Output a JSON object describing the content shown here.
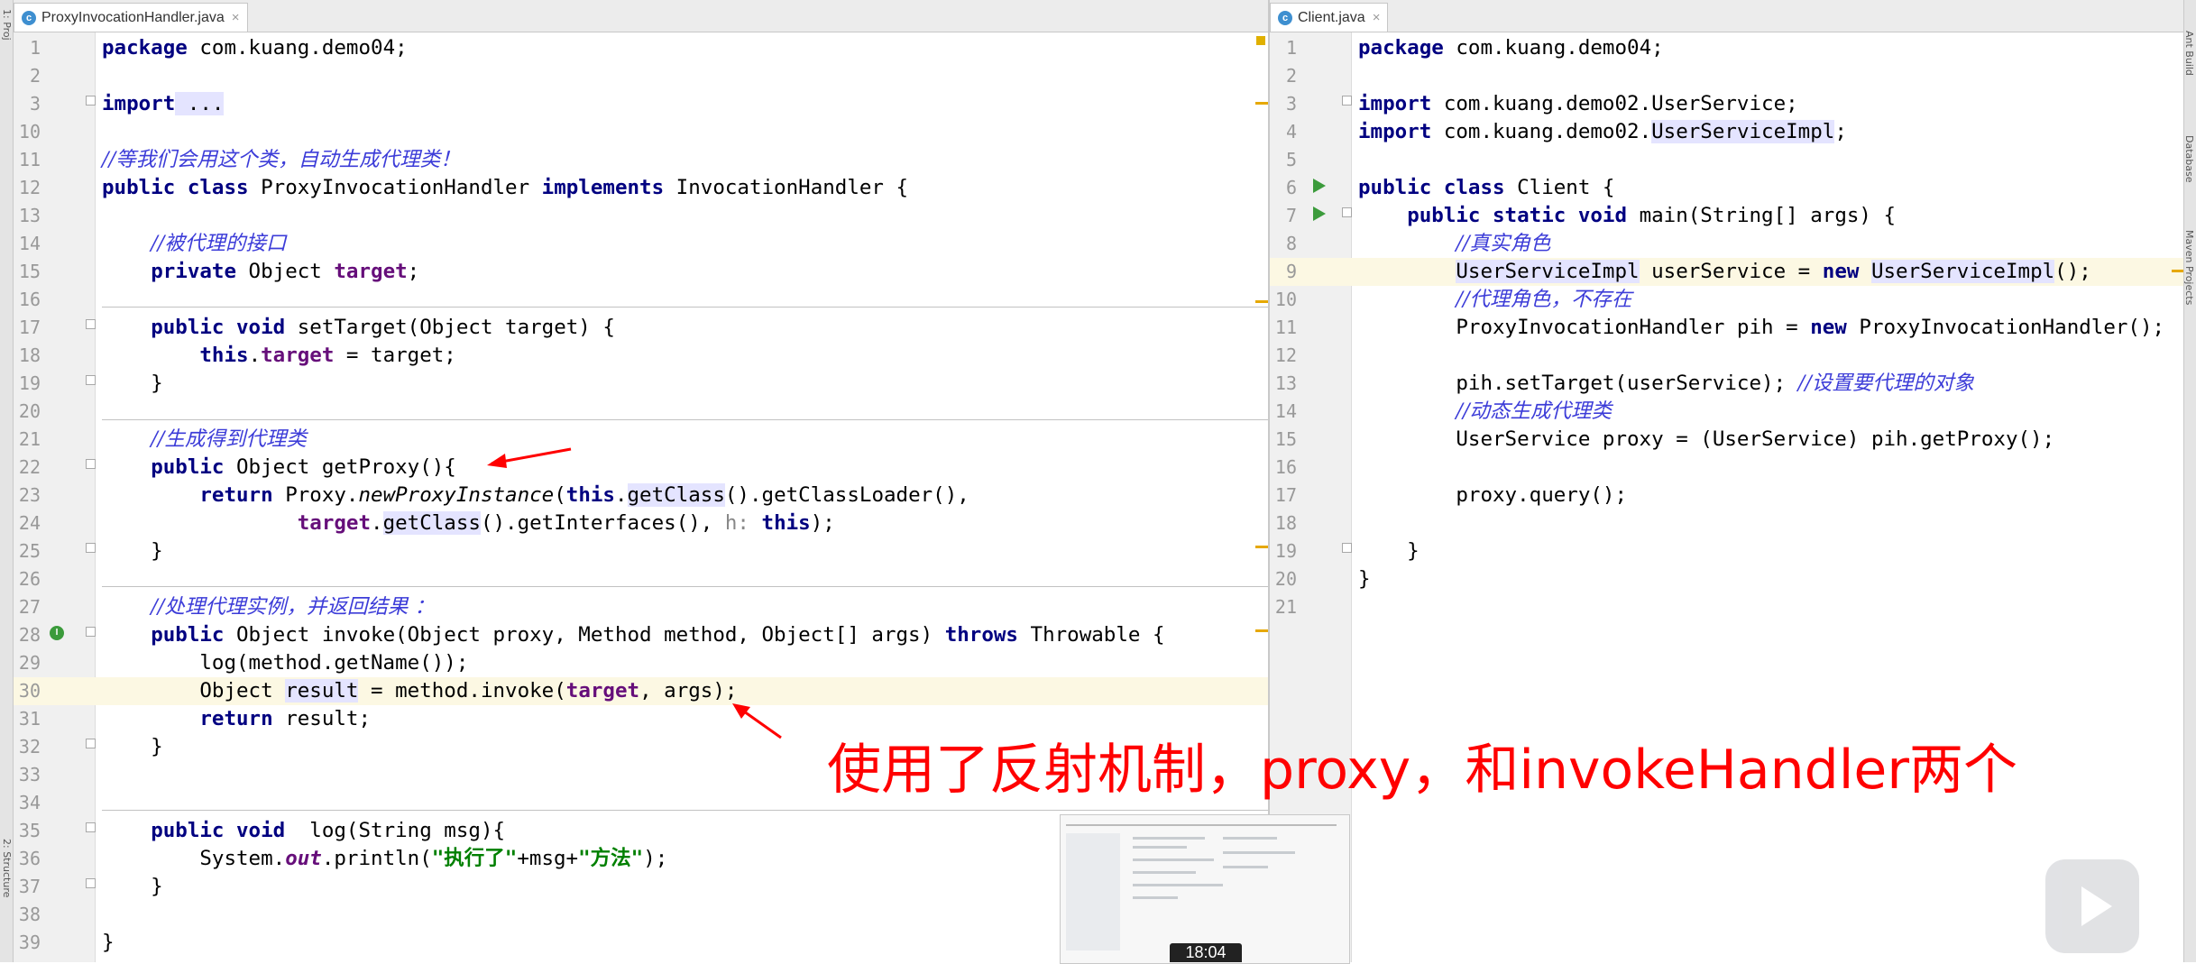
{
  "left_tab": {
    "label": "ProxyInvocationHandler.java",
    "close": "×"
  },
  "right_tab": {
    "label": "Client.java",
    "close": "×"
  },
  "left_lines": [
    {
      "no": "1",
      "code": [
        {
          "t": "package",
          "c": "kw"
        },
        {
          "t": " com.kuang.demo04;"
        }
      ]
    },
    {
      "no": "2",
      "code": []
    },
    {
      "no": "3",
      "code": [
        {
          "t": "import",
          "c": "kw"
        },
        {
          "t": " ...",
          "c": "hl"
        }
      ]
    },
    {
      "no": "10",
      "code": []
    },
    {
      "no": "11",
      "code": [
        {
          "t": "//等我们会用这个类，自动生成代理类！",
          "c": "cm"
        }
      ]
    },
    {
      "no": "12",
      "code": [
        {
          "t": "public class",
          "c": "kw"
        },
        {
          "t": " ProxyInvocationHandler "
        },
        {
          "t": "implements",
          "c": "kw"
        },
        {
          "t": " InvocationHandler {"
        }
      ]
    },
    {
      "no": "13",
      "code": []
    },
    {
      "no": "14",
      "code": [
        {
          "t": "    "
        },
        {
          "t": "//被代理的接口",
          "c": "cm"
        }
      ]
    },
    {
      "no": "15",
      "code": [
        {
          "t": "    "
        },
        {
          "t": "private",
          "c": "kw"
        },
        {
          "t": " Object "
        },
        {
          "t": "target",
          "c": "fld"
        },
        {
          "t": ";"
        }
      ]
    },
    {
      "no": "16",
      "code": []
    },
    {
      "no": "17",
      "code": [
        {
          "t": "    "
        },
        {
          "t": "public void",
          "c": "kw"
        },
        {
          "t": " setTarget(Object target) {"
        }
      ]
    },
    {
      "no": "18",
      "code": [
        {
          "t": "        "
        },
        {
          "t": "this",
          "c": "kw"
        },
        {
          "t": "."
        },
        {
          "t": "target",
          "c": "fld"
        },
        {
          "t": " = target;"
        }
      ]
    },
    {
      "no": "19",
      "code": [
        {
          "t": "    }"
        }
      ]
    },
    {
      "no": "20",
      "code": []
    },
    {
      "no": "21",
      "code": [
        {
          "t": "    "
        },
        {
          "t": "//生成得到代理类",
          "c": "cm"
        }
      ]
    },
    {
      "no": "22",
      "code": [
        {
          "t": "    "
        },
        {
          "t": "public",
          "c": "kw"
        },
        {
          "t": " Object getProxy(){"
        }
      ]
    },
    {
      "no": "23",
      "code": [
        {
          "t": "        "
        },
        {
          "t": "return",
          "c": "kw"
        },
        {
          "t": " Proxy."
        },
        {
          "t": "newProxyInstance",
          "c": "it"
        },
        {
          "t": "("
        },
        {
          "t": "this",
          "c": "kw"
        },
        {
          "t": "."
        },
        {
          "t": "getClass",
          "c": "hl"
        },
        {
          "t": "().getClassLoader(),"
        }
      ]
    },
    {
      "no": "24",
      "code": [
        {
          "t": "                "
        },
        {
          "t": "target",
          "c": "fld"
        },
        {
          "t": "."
        },
        {
          "t": "getClass",
          "c": "hl"
        },
        {
          "t": "().getInterfaces(), "
        },
        {
          "t": "h:",
          "c": "hint"
        },
        {
          "t": " "
        },
        {
          "t": "this",
          "c": "kw"
        },
        {
          "t": ");"
        }
      ]
    },
    {
      "no": "25",
      "code": [
        {
          "t": "    }"
        }
      ]
    },
    {
      "no": "26",
      "code": []
    },
    {
      "no": "27",
      "code": [
        {
          "t": "    "
        },
        {
          "t": "//处理代理实例，并返回结果 ：",
          "c": "cm"
        }
      ]
    },
    {
      "no": "28",
      "code": [
        {
          "t": "    "
        },
        {
          "t": "public",
          "c": "kw"
        },
        {
          "t": " Object invoke(Object proxy, Method method, Object[] args) "
        },
        {
          "t": "throws",
          "c": "kw"
        },
        {
          "t": " Throwable {"
        }
      ]
    },
    {
      "no": "29",
      "code": [
        {
          "t": "        log(method.getName());"
        }
      ]
    },
    {
      "no": "30",
      "code": [
        {
          "t": "        Object "
        },
        {
          "t": "result",
          "c": "hl"
        },
        {
          "t": " = method.invoke("
        },
        {
          "t": "target",
          "c": "fld"
        },
        {
          "t": ", args);"
        }
      ]
    },
    {
      "no": "31",
      "code": [
        {
          "t": "        "
        },
        {
          "t": "return",
          "c": "kw"
        },
        {
          "t": " result;"
        }
      ]
    },
    {
      "no": "32",
      "code": [
        {
          "t": "    }"
        }
      ]
    },
    {
      "no": "33",
      "code": []
    },
    {
      "no": "34",
      "code": []
    },
    {
      "no": "35",
      "code": [
        {
          "t": "    "
        },
        {
          "t": "public void",
          "c": "kw"
        },
        {
          "t": "  log(String msg){"
        }
      ]
    },
    {
      "no": "36",
      "code": [
        {
          "t": "        System."
        },
        {
          "t": "out",
          "c": "fld it"
        },
        {
          "t": ".println("
        },
        {
          "t": "\"执行了\"",
          "c": "st"
        },
        {
          "t": "+msg+"
        },
        {
          "t": "\"方法\"",
          "c": "st"
        },
        {
          "t": ");"
        }
      ]
    },
    {
      "no": "37",
      "code": [
        {
          "t": "    }"
        }
      ]
    },
    {
      "no": "38",
      "code": []
    },
    {
      "no": "39",
      "code": [
        {
          "t": "}"
        }
      ]
    }
  ],
  "right_lines": [
    {
      "no": "1",
      "code": [
        {
          "t": "package",
          "c": "kw"
        },
        {
          "t": " com.kuang.demo04;"
        }
      ]
    },
    {
      "no": "2",
      "code": []
    },
    {
      "no": "3",
      "code": [
        {
          "t": "import",
          "c": "kw"
        },
        {
          "t": " com.kuang.demo02.UserService;"
        }
      ]
    },
    {
      "no": "4",
      "code": [
        {
          "t": "import",
          "c": "kw"
        },
        {
          "t": " com.kuang.demo02."
        },
        {
          "t": "UserServiceImpl",
          "c": "hl"
        },
        {
          "t": ";"
        }
      ]
    },
    {
      "no": "5",
      "code": []
    },
    {
      "no": "6",
      "code": [
        {
          "t": "public class",
          "c": "kw"
        },
        {
          "t": " Client {"
        }
      ]
    },
    {
      "no": "7",
      "code": [
        {
          "t": "    "
        },
        {
          "t": "public static void",
          "c": "kw"
        },
        {
          "t": " main(String[] args) {"
        }
      ]
    },
    {
      "no": "8",
      "code": [
        {
          "t": "        "
        },
        {
          "t": "//真实角色",
          "c": "cm"
        }
      ]
    },
    {
      "no": "9",
      "code": [
        {
          "t": "        "
        },
        {
          "t": "UserServiceImpl",
          "c": "hl"
        },
        {
          "t": " userService = "
        },
        {
          "t": "new",
          "c": "kw"
        },
        {
          "t": " "
        },
        {
          "t": "UserServiceImpl",
          "c": "hl"
        },
        {
          "t": "();"
        }
      ]
    },
    {
      "no": "10",
      "code": [
        {
          "t": "        "
        },
        {
          "t": "//代理角色，不存在",
          "c": "cm"
        }
      ]
    },
    {
      "no": "11",
      "code": [
        {
          "t": "        ProxyInvocationHandler pih = "
        },
        {
          "t": "new",
          "c": "kw"
        },
        {
          "t": " ProxyInvocationHandler();"
        }
      ]
    },
    {
      "no": "12",
      "code": []
    },
    {
      "no": "13",
      "code": [
        {
          "t": "        pih.setTarget(userService); "
        },
        {
          "t": "//设置要代理的对象",
          "c": "cm"
        }
      ]
    },
    {
      "no": "14",
      "code": [
        {
          "t": "        "
        },
        {
          "t": "//动态生成代理类",
          "c": "cm"
        }
      ]
    },
    {
      "no": "15",
      "code": [
        {
          "t": "        UserService proxy = (UserService) pih.getProxy();"
        }
      ]
    },
    {
      "no": "16",
      "code": []
    },
    {
      "no": "17",
      "code": [
        {
          "t": "        proxy.query();"
        }
      ]
    },
    {
      "no": "18",
      "code": []
    },
    {
      "no": "19",
      "code": [
        {
          "t": "    }"
        }
      ]
    },
    {
      "no": "20",
      "code": [
        {
          "t": "}"
        }
      ]
    },
    {
      "no": "21",
      "code": []
    }
  ],
  "annotation": "使用了反射机制，proxy，和invokeHandler两个",
  "video_time": "18:04",
  "side_left_top": "1: Proj",
  "side_left_bottom": "2: Structure",
  "side_right_top": "Ant Build",
  "side_right_mid": "Database",
  "side_right_low": "Maven Projects"
}
